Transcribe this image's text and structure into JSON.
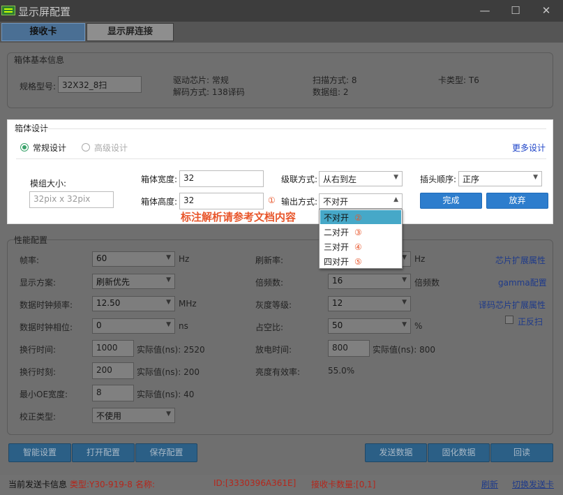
{
  "window": {
    "title": "显示屏配置",
    "min": "—",
    "max": "☐",
    "close": "✕"
  },
  "tabs": [
    {
      "label": "接收卡"
    },
    {
      "label": "显示屏连接"
    }
  ],
  "basic_info": {
    "section_title": "箱体基本信息",
    "model_label": "规格型号:",
    "model_value": "32X32_8扫",
    "driver_chip": "驱动芯片: 常规",
    "decode_mode": "解码方式: 138译码",
    "scan_mode": "扫描方式: 8",
    "data_groups": "数据组: 2",
    "card_type": "卡类型: T6"
  },
  "box_design": {
    "section_title": "箱体设计",
    "radio_normal": "常规设计",
    "radio_advanced": "高级设计",
    "more_design": "更多设计",
    "module_size_label": "模组大小:",
    "module_size_value": "32pix x 32pix",
    "width_label": "箱体宽度:",
    "width_value": "32",
    "height_label": "箱体高度:",
    "height_value": "32",
    "cascade_label": "级联方式:",
    "cascade_value": "从右到左",
    "output_marker": "①",
    "output_label": "输出方式:",
    "output_value": "不对开",
    "plug_label": "插头顺序:",
    "plug_value": "正序",
    "done_button": "完成",
    "discard_button": "放弃",
    "annotation": "标注解析请参考文档内容",
    "dropdown": [
      {
        "label": "不对开",
        "marker": "②"
      },
      {
        "label": "二对开",
        "marker": "③"
      },
      {
        "label": "三对开",
        "marker": "④"
      },
      {
        "label": "四对开",
        "marker": "⑤"
      }
    ]
  },
  "perf": {
    "section_title": "性能配置",
    "frame_rate_label": "帧率:",
    "frame_rate_value": "60",
    "frame_rate_unit": "Hz",
    "display_mode_label": "显示方案:",
    "display_mode_value": "刷新优先",
    "clock_freq_label": "数据时钟频率:",
    "clock_freq_value": "12.50",
    "clock_freq_unit": "MHz",
    "clock_phase_label": "数据时钟相位:",
    "clock_phase_value": "0",
    "clock_phase_unit": "ns",
    "line_time_label": "换行时间:",
    "line_time_value": "1000",
    "line_time_actual": "实际值(ns): 2520",
    "line_moment_label": "换行时刻:",
    "line_moment_value": "200",
    "line_moment_actual": "实际值(ns): 200",
    "min_oe_label": "最小OE宽度:",
    "min_oe_value": "8",
    "min_oe_actual": "实际值(ns): 40",
    "correction_label": "校正类型:",
    "correction_value": "不使用",
    "refresh_label": "刷新率:",
    "refresh_unit": "Hz",
    "multiplier_label": "倍频数:",
    "multiplier_value": "16",
    "multiplier_unit": "倍频数",
    "gray_label": "灰度等级:",
    "gray_value": "12",
    "duty_label": "占空比:",
    "duty_value": "50",
    "duty_unit": "%",
    "discharge_label": "放电时间:",
    "discharge_value": "800",
    "discharge_actual": "实际值(ns): 800",
    "brightness_label": "亮度有效率:",
    "brightness_value": "55.0%",
    "chip_ext": "芯片扩展属性",
    "gamma": "gamma配置",
    "decode_ext": "译码芯片扩展属性",
    "reverse_label": "正反扫"
  },
  "bottom_buttons": {
    "smart": "智能设置",
    "open": "打开配置",
    "save": "保存配置",
    "send": "发送数据",
    "solidify": "固化数据",
    "readback": "回读"
  },
  "status": {
    "label": "当前发送卡信息",
    "type": "类型:Y30-919-80",
    "name": "名称:",
    "id": "ID:[3330396A361E]",
    "count": "接收卡数量:[0,1]",
    "refresh": "刷新",
    "switch": "切换发送卡"
  }
}
